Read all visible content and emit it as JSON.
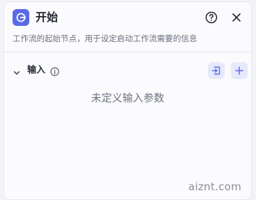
{
  "header": {
    "title": "开始",
    "description": "工作流的起始节点，用于设定启动工作流需要的信息"
  },
  "input_section": {
    "title": "输入",
    "empty_message": "未定义输入参数"
  },
  "icons": {
    "app": "start-node-icon",
    "help": "question-circle-icon",
    "close": "close-icon",
    "collapse": "chevron-down-icon",
    "info": "info-icon",
    "import": "import-icon",
    "add": "plus-icon"
  },
  "colors": {
    "accent": "#5b6ae8",
    "button_bg": "#e6e8fb"
  },
  "watermark": "aiznt.com"
}
